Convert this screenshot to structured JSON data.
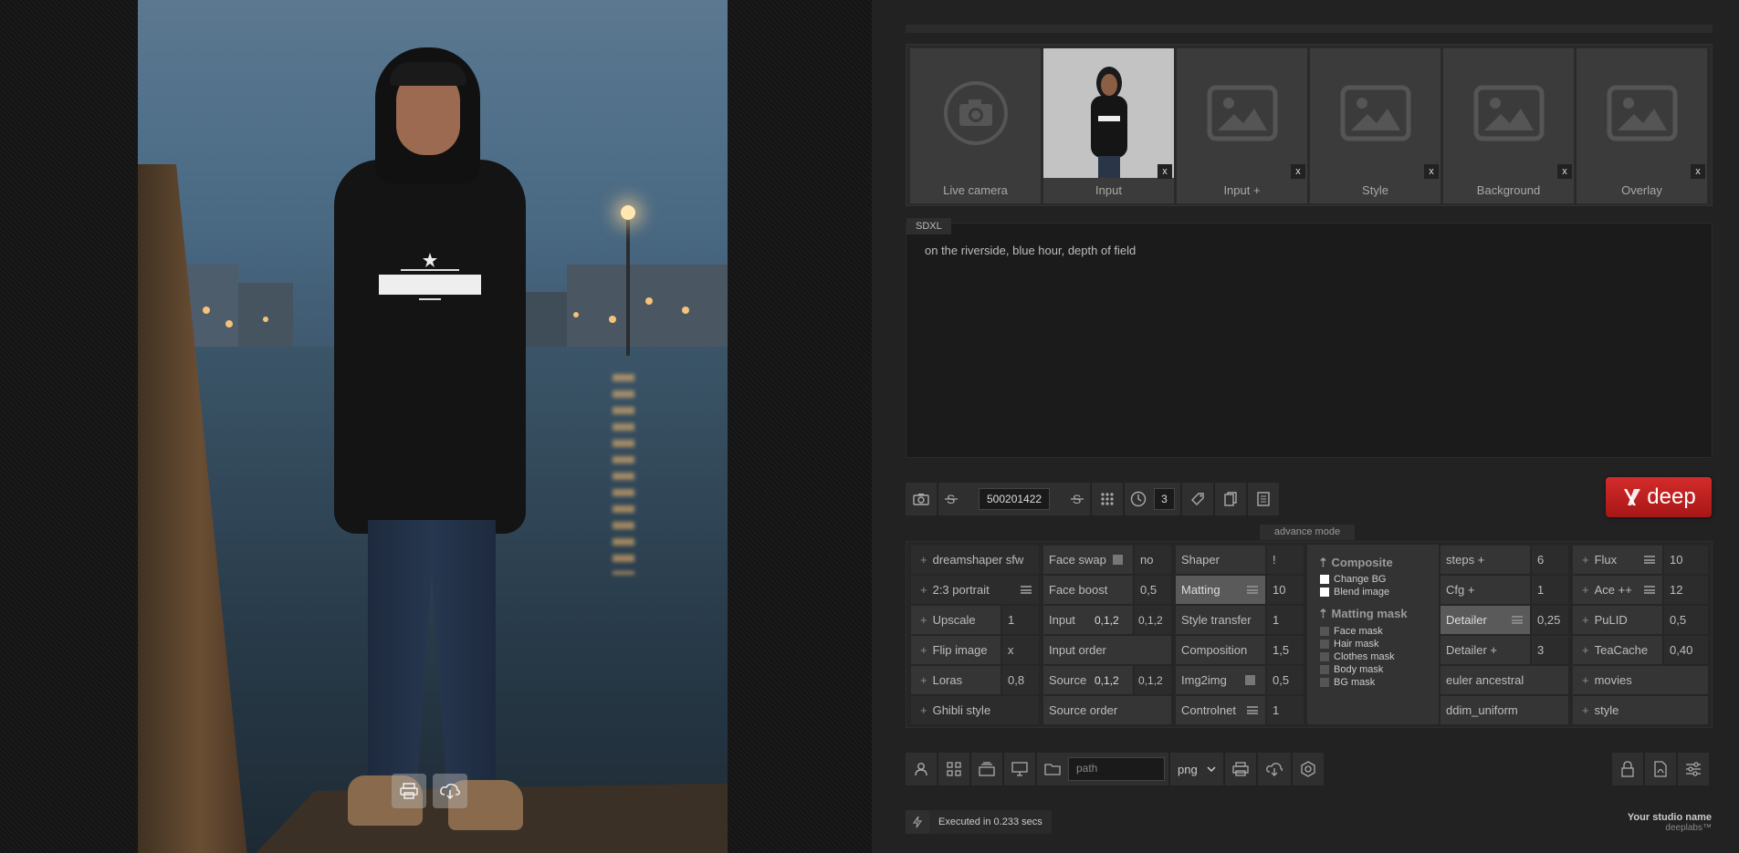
{
  "photo_buttons": {
    "print": "print-icon",
    "cloud": "cloud-download-icon"
  },
  "slots": [
    {
      "label": "Live camera",
      "icon": "camera-icon",
      "has_close": false
    },
    {
      "label": "Input",
      "icon": "thumbnail",
      "has_close": true,
      "close": "x"
    },
    {
      "label": "Input +",
      "icon": "image-icon",
      "has_close": true,
      "close": "x"
    },
    {
      "label": "Style",
      "icon": "image-icon",
      "has_close": true,
      "close": "x"
    },
    {
      "label": "Background",
      "icon": "image-icon",
      "has_close": true,
      "close": "x"
    },
    {
      "label": "Overlay",
      "icon": "image-icon",
      "has_close": true,
      "close": "x"
    }
  ],
  "prompt": {
    "model_tag": "SDXL",
    "text": "on the riverside, blue hour, depth of field"
  },
  "toolbar": {
    "seed": "500201422",
    "count": "3"
  },
  "deep_button": {
    "label": "deep",
    "color": "#c21f1f"
  },
  "advance_mode": "advance mode",
  "grid": {
    "col1": [
      {
        "label": "dreamshaper sfw",
        "value": ""
      },
      {
        "label": "2:3 portrait",
        "value": ""
      },
      {
        "label": "Upscale",
        "value": "1"
      },
      {
        "label": "Flip image",
        "value": "x"
      },
      {
        "label": "Loras",
        "value": "0,8"
      },
      {
        "label": "Ghibli style",
        "value": ""
      }
    ],
    "col2": [
      {
        "label": "Face swap",
        "value": "no"
      },
      {
        "label": "Face boost",
        "value": "0,5"
      },
      {
        "label": "Input",
        "value1": "0,1,2",
        "value2": "0,1,2"
      },
      {
        "label": "Input order",
        "value": ""
      },
      {
        "label": "Source",
        "value1": "0,1,2",
        "value2": "0,1,2"
      },
      {
        "label": "Source order",
        "value": ""
      }
    ],
    "col3": [
      {
        "label": "Shaper",
        "value": "!"
      },
      {
        "label": "Matting",
        "value": "10"
      },
      {
        "label": "Style transfer",
        "value": "1"
      },
      {
        "label": "Composition",
        "value": "1,5"
      },
      {
        "label": "Img2img",
        "value": "0,5"
      },
      {
        "label": "Controlnet",
        "value": "1"
      }
    ],
    "composite": {
      "title": "Composite",
      "items": [
        "Change BG",
        "Blend image"
      ],
      "mask_title": "Matting mask",
      "masks": [
        "Face mask",
        "Hair mask",
        "Clothes mask",
        "Body mask",
        "BG mask"
      ]
    },
    "col5": [
      {
        "label": "steps +",
        "value": "6"
      },
      {
        "label": "Cfg +",
        "value": "1"
      },
      {
        "label": "Detailer",
        "value": "0,25"
      },
      {
        "label": "Detailer +",
        "value": "3"
      },
      {
        "label": "euler ancestral",
        "value": ""
      },
      {
        "label": "ddim_uniform",
        "value": ""
      }
    ],
    "col6": [
      {
        "label": "Flux",
        "value": "10"
      },
      {
        "label": "Ace ++",
        "value": "12"
      },
      {
        "label": "PuLID",
        "value": "0,5"
      },
      {
        "label": "TeaCache",
        "value": "0,40"
      },
      {
        "label": "movies",
        "value": ""
      },
      {
        "label": "style",
        "value": ""
      }
    ]
  },
  "bottom": {
    "path_placeholder": "path",
    "format": "png"
  },
  "status": {
    "text": "Executed in 0.233 secs"
  },
  "studio": {
    "name": "Your studio name",
    "sub": "deeplabs™"
  }
}
